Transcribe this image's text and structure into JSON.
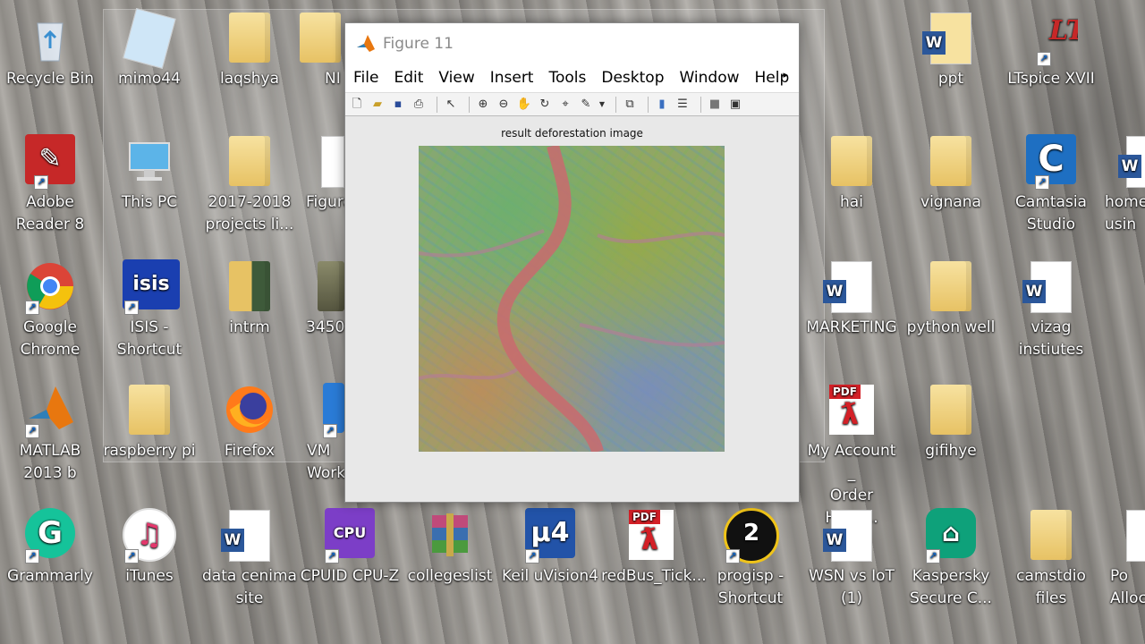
{
  "desktop": {
    "icons": [
      {
        "id": "recycle-bin",
        "label": "Recycle Bin"
      },
      {
        "id": "mimo44",
        "label": "mimo44"
      },
      {
        "id": "laqshya",
        "label": "laqshya"
      },
      {
        "id": "ni",
        "label": "NI"
      },
      {
        "id": "ppt",
        "label": "ppt"
      },
      {
        "id": "ltspice",
        "label": "LTspice XVII"
      },
      {
        "id": "adobe-reader",
        "label": "Adobe\nReader 8"
      },
      {
        "id": "this-pc",
        "label": "This PC"
      },
      {
        "id": "projects",
        "label": "2017-2018\nprojects li..."
      },
      {
        "id": "figure",
        "label": "Figure"
      },
      {
        "id": "hai",
        "label": "hai"
      },
      {
        "id": "vignana",
        "label": "vignana"
      },
      {
        "id": "camtasia",
        "label": "Camtasia\nStudio"
      },
      {
        "id": "home",
        "label": "home\nusin"
      },
      {
        "id": "google-chrome",
        "label": "Google\nChrome"
      },
      {
        "id": "isis",
        "label": "ISIS -\nShortcut"
      },
      {
        "id": "intrm",
        "label": "intrm"
      },
      {
        "id": "3450",
        "label": "3450"
      },
      {
        "id": "marketing",
        "label": "MARKETING"
      },
      {
        "id": "python-well",
        "label": "python well"
      },
      {
        "id": "vizag",
        "label": "vizag\ninstiutes"
      },
      {
        "id": "matlab",
        "label": "MATLAB\n2013 b"
      },
      {
        "id": "raspberry",
        "label": "raspberry pi"
      },
      {
        "id": "firefox",
        "label": "Firefox"
      },
      {
        "id": "vmware",
        "label": "VM\nWork"
      },
      {
        "id": "myaccount",
        "label": "My Account _\nOrder Histo..."
      },
      {
        "id": "gifihye",
        "label": "gifihye"
      },
      {
        "id": "grammarly",
        "label": "Grammarly"
      },
      {
        "id": "itunes",
        "label": "iTunes"
      },
      {
        "id": "data-cenima",
        "label": "data cenima\nsite"
      },
      {
        "id": "cpuz",
        "label": "CPUID CPU-Z"
      },
      {
        "id": "collegeslist",
        "label": "collegeslist"
      },
      {
        "id": "keil",
        "label": "Keil uVision4"
      },
      {
        "id": "redbus",
        "label": "redBus_Tick..."
      },
      {
        "id": "progisp",
        "label": "progisp -\nShortcut"
      },
      {
        "id": "wsn",
        "label": "WSN vs IoT\n(1)"
      },
      {
        "id": "kaspersky",
        "label": "Kaspersky\nSecure C..."
      },
      {
        "id": "camstdio",
        "label": "camstdio\nfiles"
      },
      {
        "id": "pc-alloc",
        "label": "Po\nAlloca"
      }
    ]
  },
  "figure_window": {
    "title": "Figure 11",
    "menu": [
      "File",
      "Edit",
      "View",
      "Insert",
      "Tools",
      "Desktop",
      "Window",
      "Help"
    ],
    "menu_more": "▸",
    "axes_title": "result deforestation image",
    "toolbar_icons": [
      "new-figure-icon",
      "open-file-icon",
      "save-icon",
      "print-icon",
      "select-pointer-icon",
      "zoom-in-icon",
      "zoom-out-icon",
      "pan-hand-icon",
      "rotate-3d-icon",
      "data-cursor-icon",
      "brush-icon",
      "dropdown-arrow-icon",
      "link-plot-icon",
      "insert-colorbar-icon",
      "insert-legend-icon",
      "hide-plot-tools-icon",
      "show-plot-tools-icon"
    ]
  },
  "colors": {
    "matlab_orange": "#e8770f",
    "word_blue": "#2b579a",
    "pdf_red": "#d32027",
    "river": "#c96a6e"
  }
}
